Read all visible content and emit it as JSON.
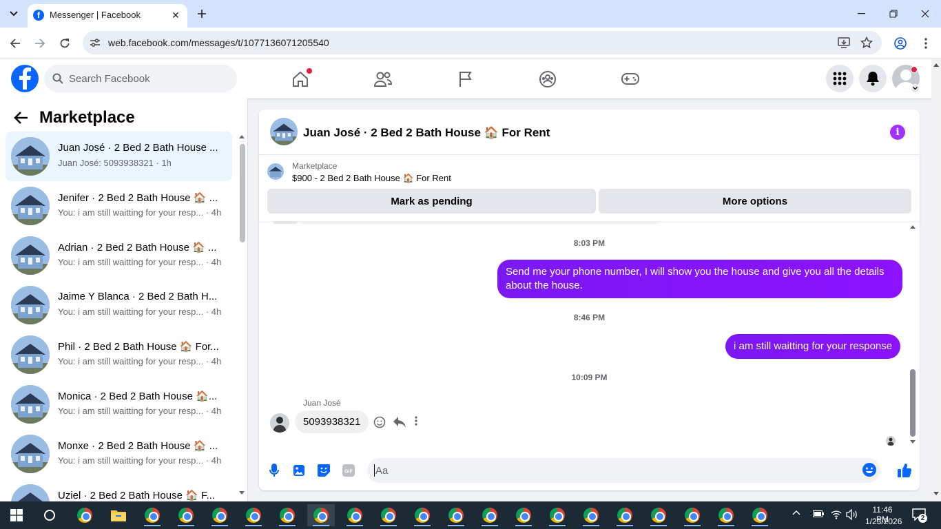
{
  "browser": {
    "tab_title": "Messenger | Facebook",
    "url": "web.facebook.com/messages/t/1077136071205540"
  },
  "fb_header": {
    "search_placeholder": "Search Facebook"
  },
  "sidebar": {
    "title": "Marketplace",
    "conversations": [
      {
        "name": "Juan José · 2 Bed 2 Bath House ...",
        "preview": "Juan José: 5093938321 · 1h",
        "active": true
      },
      {
        "name": "Jenifer · 2 Bed 2 Bath House 🏠 ...",
        "preview": "You: i am still waitting for your resp... · 4h"
      },
      {
        "name": "Adrian · 2 Bed 2 Bath House 🏠 ...",
        "preview": "You: i am still waitting for your resp... · 4h"
      },
      {
        "name": "Jaime Y Blanca · 2 Bed 2 Bath H...",
        "preview": "You: i am still waitting for your resp... · 4h"
      },
      {
        "name": "Phil · 2 Bed 2 Bath House 🏠 For...",
        "preview": "You: i am still waitting for your resp... · 4h"
      },
      {
        "name": "Monica · 2 Bed 2 Bath House 🏠...",
        "preview": "You: i am still waitting for your resp... · 4h"
      },
      {
        "name": "Monxe · 2 Bed 2 Bath House 🏠 ...",
        "preview": "You: i am still waitting for your resp... · 4h"
      },
      {
        "name": "Uziel · 2 Bed 2 Bath House 🏠 F...",
        "preview": ""
      }
    ]
  },
  "chat": {
    "title": "Juan José · 2 Bed 2 Bath House 🏠 For Rent",
    "listing_label": "Marketplace",
    "listing_title": "$900 - 2 Bed 2 Bath House 🏠 For Rent",
    "mark_pending": "Mark as pending",
    "more_options": "More options",
    "messages": [
      {
        "time": "8:03 PM"
      },
      {
        "text": "Send me your phone number, I will show you the house and give you all the details about the house."
      },
      {
        "time": "8:46 PM"
      },
      {
        "text": "i am still waitting for your response"
      },
      {
        "time": "10:09 PM"
      },
      {
        "sender": "Juan José",
        "text": "5093938321"
      }
    ],
    "composer_placeholder": "Aa"
  },
  "taskbar": {
    "time": "11:46 PM",
    "date": "1/23/2026",
    "notifications": "2"
  },
  "colors": {
    "fb_blue": "#0866ff",
    "bubble_purple": "#8a11ff",
    "taskbar": "#1c2a36"
  }
}
